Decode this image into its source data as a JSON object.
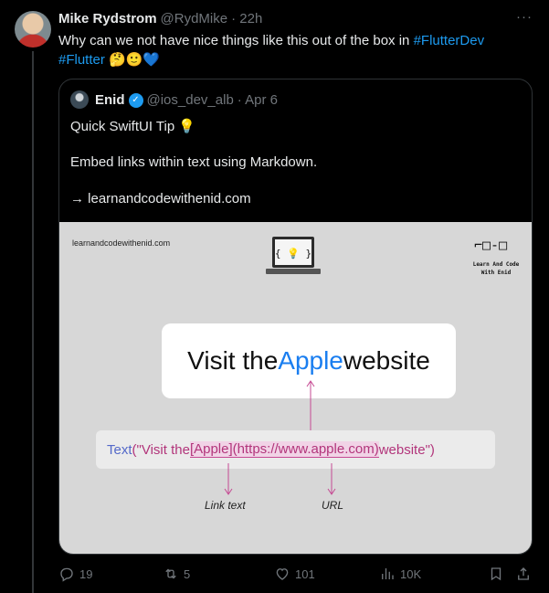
{
  "tweet": {
    "author_name": "Mike Rydstrom",
    "author_handle": "@RydMike",
    "time": "· 22h",
    "more": "···",
    "text_prefix": "Why can we not have nice things like this out of the box in ",
    "hashtag1": "#FlutterDev",
    "hashtag2": "#Flutter",
    "emoji": "🤔🙂💙"
  },
  "quote": {
    "author_name": "Enid",
    "verified_mark": "✓",
    "author_handle": "@ios_dev_alb",
    "date": "· Apr 6",
    "line1": "Quick SwiftUI Tip 💡",
    "line2": "Embed links within text using Markdown.",
    "line3": "→ learnandcodewithenid.com"
  },
  "media": {
    "site_small": "learnandcodewithenid.com",
    "laptop_braces": "{ 💡 }",
    "glasses": "⌐□-□",
    "brand": "Learn And Code With Enid",
    "preview_pre": "Visit the ",
    "preview_link": "Apple",
    "preview_post": " website",
    "code_kw": "Text",
    "code_open": "(",
    "code_str1": "\"Visit the ",
    "code_hl1": "[Apple]",
    "code_hl2": "(https://www.apple.com)",
    "code_str2": " website\"",
    "code_close": ")",
    "caption_link": "Link text",
    "caption_url": "URL"
  },
  "actions": {
    "replies": "19",
    "reposts": "5",
    "likes": "101",
    "views": "10K"
  },
  "colors": {
    "accent": "#1d9bf0",
    "muted": "#71767b",
    "background": "#000000"
  }
}
